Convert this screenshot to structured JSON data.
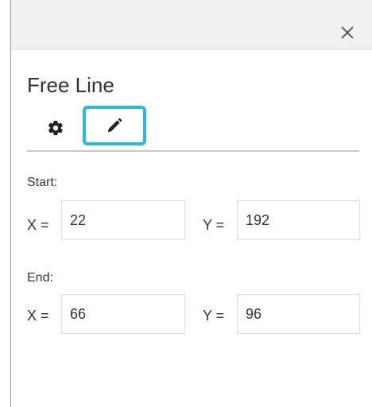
{
  "window": {
    "close_glyph": "✕"
  },
  "panel": {
    "title": "Free Line",
    "tabs": [
      {
        "icon": "gear-icon",
        "selected": false
      },
      {
        "icon": "pencil-icon",
        "selected": true
      }
    ]
  },
  "start": {
    "label": "Start:",
    "x_label": "X =",
    "x_value": "22",
    "y_label": "Y =",
    "y_value": "192"
  },
  "end": {
    "label": "End:",
    "x_label": "X =",
    "x_value": "66",
    "y_label": "Y =",
    "y_value": "96"
  },
  "colors": {
    "accent": "#29b7e4",
    "text": "#333333",
    "field_border": "#dcdcdc"
  }
}
